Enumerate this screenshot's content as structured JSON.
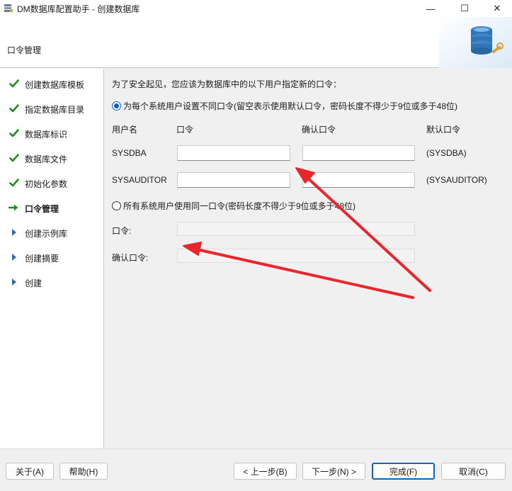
{
  "window": {
    "title": "DM数据库配置助手 - 创建数据库",
    "min_glyph": "—",
    "max_glyph": "☐",
    "close_glyph": "✕"
  },
  "header": {
    "title": "口令管理"
  },
  "sidebar": {
    "steps": [
      {
        "label": "创建数据库模板",
        "state": "done"
      },
      {
        "label": "指定数据库目录",
        "state": "done"
      },
      {
        "label": "数据库标识",
        "state": "done"
      },
      {
        "label": "数据库文件",
        "state": "done"
      },
      {
        "label": "初始化参数",
        "state": "done"
      },
      {
        "label": "口令管理",
        "state": "current"
      },
      {
        "label": "创建示例库",
        "state": "pending"
      },
      {
        "label": "创建摘要",
        "state": "pending"
      },
      {
        "label": "创建",
        "state": "pending"
      }
    ]
  },
  "main": {
    "intro": "为了安全起见，您应该为数据库中的以下用户指定新的口令：",
    "option_different": "为每个系统用户设置不同口令(留空表示使用默认口令，密码长度不得少于9位或多于48位)",
    "option_same": "所有系统用户使用同一口令(密码长度不得少于9位或多于48位)",
    "columns": {
      "user": "用户名",
      "password": "口令",
      "confirm": "确认口令",
      "default": "默认口令"
    },
    "users": [
      {
        "name": "SYSDBA",
        "password": "",
        "confirm": "",
        "default": "(SYSDBA)"
      },
      {
        "name": "SYSAUDITOR",
        "password": "",
        "confirm": "",
        "default": "(SYSAUDITOR)"
      }
    ],
    "shared_password_label": "口令:",
    "shared_confirm_label": "确认口令:",
    "shared_password_value": "",
    "shared_confirm_value": ""
  },
  "footer": {
    "about": "关于(A)",
    "help": "帮助(H)",
    "prev": "< 上一步(B)",
    "next": "下一步(N) >",
    "finish": "完成(F)",
    "cancel": "取消(C)"
  },
  "colors": {
    "check_green": "#1e8c1e",
    "arrow_blue": "#2a6fbf",
    "current_arrow": "#1e8c1e",
    "annotation_red": "#e8262b",
    "accent_blue": "#0067c0"
  },
  "icons": {
    "done": "checkmark-icon",
    "current": "right-arrow-icon",
    "pending": "triangle-right-icon"
  }
}
